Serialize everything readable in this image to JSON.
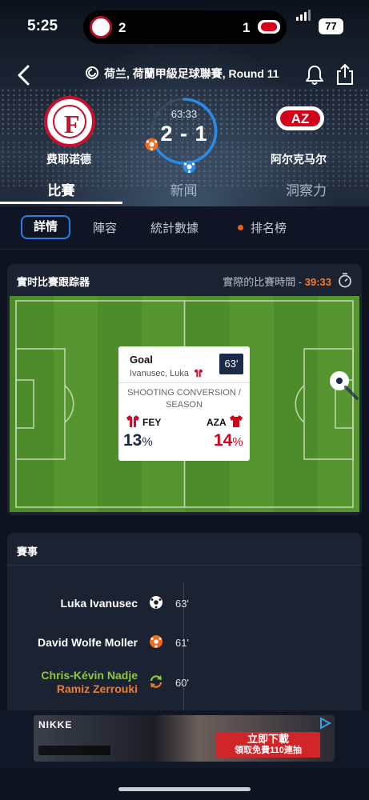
{
  "status_bar": {
    "time": "5:25",
    "home_score": "2",
    "away_score": "1",
    "battery": "77"
  },
  "header": {
    "league_title": "荷兰, 荷蘭甲級足球聯賽, Round 11",
    "home_team": "费耶诺德",
    "away_team": "阿尔克马尔",
    "away_crest_text": "AZ",
    "match_time": "63:33",
    "score": "2 - 1"
  },
  "top_tabs": [
    "比賽",
    "新闻",
    "洞察力"
  ],
  "sub_tabs": {
    "details": "詳情",
    "lineup": "陣容",
    "stats": "統計數據",
    "standings": "排名榜"
  },
  "tracker": {
    "title": "實时比賽跟踪器",
    "actual_time_label": "實際的比賽時間 - ",
    "actual_time_value": "39:33",
    "popup": {
      "event": "Goal",
      "player": "Ivanusec, Luka",
      "minute": "63'",
      "stat_label": "SHOOTING CONVERSION / SEASON",
      "home_abbr": "FEY",
      "away_abbr": "AZA",
      "home_pct": "13",
      "away_pct": "14",
      "pct_sign": "%"
    }
  },
  "events": {
    "title": "賽事",
    "items": [
      {
        "name": "Luka Ivanusec",
        "minute": "63'",
        "icon": "goal-ball-icon"
      },
      {
        "name": "David Wolfe Moller",
        "minute": "61'",
        "icon": "own-goal-ball-icon"
      },
      {
        "name_in": "Chris-Kévin Nadje",
        "name_out": "Ramiz Zerrouki",
        "minute": "60'",
        "icon": "substitution-icon"
      }
    ]
  },
  "ad": {
    "brand": "NIKKE",
    "cta_line1": "立即下載",
    "cta_line2": "領取免費110連抽"
  },
  "colors": {
    "accent_blue": "#2a7fe0",
    "accent_orange": "#f07c2a",
    "home_red": "#c8102e",
    "away_red": "#d4001a",
    "sub_green": "#8fc63f"
  }
}
